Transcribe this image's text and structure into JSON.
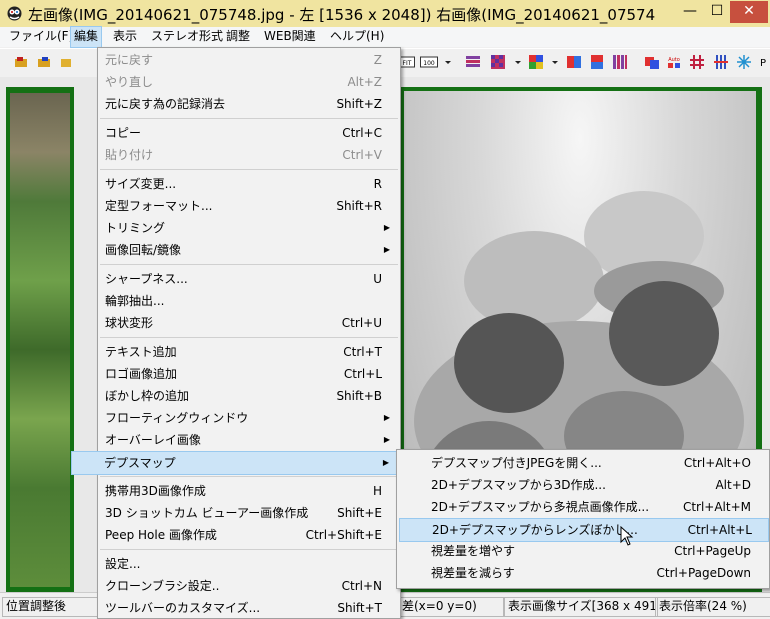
{
  "window": {
    "title": "左画像(IMG_20140621_075748.jpg - 左 [1536 x 2048]) 右画像(IMG_20140621_07574",
    "minimize": "—",
    "maximize": "☐",
    "close": "✕"
  },
  "menubar": [
    {
      "label": "ファイル(F)",
      "active": false
    },
    {
      "label": "編集",
      "active": true
    },
    {
      "label": "表示",
      "active": false
    },
    {
      "label": "ステレオ形式",
      "active": false
    },
    {
      "label": "調整",
      "active": false
    },
    {
      "label": "WEB関連",
      "active": false
    },
    {
      "label": "ヘルプ(H)",
      "active": false
    }
  ],
  "toolbar": {
    "fit_label": "FIT",
    "hundred_label": "100",
    "auto_label": "Auto",
    "p_label": "P"
  },
  "edit_menu": {
    "items": [
      {
        "label": "元に戻す",
        "shortcut": "Z",
        "disabled": true
      },
      {
        "label": "やり直し",
        "shortcut": "Alt+Z",
        "disabled": true
      },
      {
        "label": "元に戻す為の記録消去",
        "shortcut": "Shift+Z"
      },
      {
        "label": "コピー",
        "shortcut": "Ctrl+C"
      },
      {
        "label": "貼り付け",
        "shortcut": "Ctrl+V",
        "disabled": true
      },
      {
        "label": "サイズ変更...",
        "shortcut": "R"
      },
      {
        "label": "定型フォーマット...",
        "shortcut": "Shift+R"
      },
      {
        "label": "トリミング",
        "submenu": true
      },
      {
        "label": "画像回転/鏡像",
        "submenu": true
      },
      {
        "label": "シャープネス...",
        "shortcut": "U"
      },
      {
        "label": "輪郭抽出...",
        "shortcut": ""
      },
      {
        "label": "球状変形",
        "shortcut": "Ctrl+U"
      },
      {
        "label": "テキスト追加",
        "shortcut": "Ctrl+T"
      },
      {
        "label": "ロゴ画像追加",
        "shortcut": "Ctrl+L"
      },
      {
        "label": "ぼかし枠の追加",
        "shortcut": "Shift+B"
      },
      {
        "label": "フローティングウィンドウ",
        "submenu": true
      },
      {
        "label": "オーバーレイ画像",
        "submenu": true
      },
      {
        "label": "デプスマップ",
        "submenu": true,
        "highlight": true
      },
      {
        "label": "携帯用3D画像作成",
        "shortcut": "H"
      },
      {
        "label": "3D ショットカム ビューアー画像作成",
        "shortcut": "Shift+E"
      },
      {
        "label": "Peep Hole 画像作成",
        "shortcut": "Ctrl+Shift+E"
      },
      {
        "label": "設定...",
        "shortcut": ""
      },
      {
        "label": "クローンブラシ設定..",
        "shortcut": "Ctrl+N"
      },
      {
        "label": "ツールバーのカスタマイズ...",
        "shortcut": "Shift+T"
      }
    ]
  },
  "depth_submenu": {
    "items": [
      {
        "label": "デプスマップ付きJPEGを開く...",
        "shortcut": "Ctrl+Alt+O"
      },
      {
        "label": "2D+デプスマップから3D作成...",
        "shortcut": "Alt+D"
      },
      {
        "label": "2D+デプスマップから多視点画像作成...",
        "shortcut": "Ctrl+Alt+M"
      },
      {
        "label": "2D+デプスマップからレンズぼかし...",
        "shortcut": "Ctrl+Alt+L",
        "highlight": true
      },
      {
        "label": "視差量を増やす",
        "shortcut": "Ctrl+PageUp"
      },
      {
        "label": "視差量を減らす",
        "shortcut": "Ctrl+PageDown"
      }
    ]
  },
  "statusbar": {
    "position": "位置調整後",
    "coords": "差(x=0 y=0)",
    "display_size": "表示画像サイズ[368 x 491]",
    "zoom": "表示倍率(24 %)"
  },
  "colors": {
    "title_bg": "#f0e4a0",
    "close_btn": "#c7503e",
    "highlight": "#cce4f7",
    "frame_green": "#147014"
  }
}
